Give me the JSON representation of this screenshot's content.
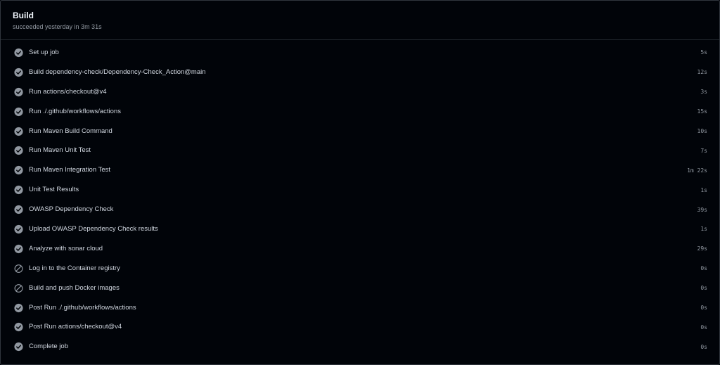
{
  "job": {
    "title": "Build",
    "status": "succeeded yesterday in 3m 31s"
  },
  "colors": {
    "background": "#010409",
    "icon": "#9198a1",
    "text": "#d1d7e0",
    "muted": "#9198a1"
  },
  "steps": [
    {
      "name": "Set up job",
      "duration": "5s",
      "status": "success",
      "icon": "check-circle-icon"
    },
    {
      "name": "Build dependency-check/Dependency-Check_Action@main",
      "duration": "12s",
      "status": "success",
      "icon": "check-circle-icon"
    },
    {
      "name": "Run actions/checkout@v4",
      "duration": "3s",
      "status": "success",
      "icon": "check-circle-icon"
    },
    {
      "name": "Run ./.github/workflows/actions",
      "duration": "15s",
      "status": "success",
      "icon": "check-circle-icon"
    },
    {
      "name": "Run Maven Build Command",
      "duration": "10s",
      "status": "success",
      "icon": "check-circle-icon"
    },
    {
      "name": "Run Maven Unit Test",
      "duration": "7s",
      "status": "success",
      "icon": "check-circle-icon"
    },
    {
      "name": "Run Maven Integration Test",
      "duration": "1m 22s",
      "status": "success",
      "icon": "check-circle-icon"
    },
    {
      "name": "Unit Test Results",
      "duration": "1s",
      "status": "success",
      "icon": "check-circle-icon"
    },
    {
      "name": "OWASP Dependency Check",
      "duration": "39s",
      "status": "success",
      "icon": "check-circle-icon"
    },
    {
      "name": "Upload OWASP Dependency Check results",
      "duration": "1s",
      "status": "success",
      "icon": "check-circle-icon"
    },
    {
      "name": "Analyze with sonar cloud",
      "duration": "29s",
      "status": "success",
      "icon": "check-circle-icon"
    },
    {
      "name": "Log in to the Container registry",
      "duration": "0s",
      "status": "skipped",
      "icon": "skipped-icon"
    },
    {
      "name": "Build and push Docker images",
      "duration": "0s",
      "status": "skipped",
      "icon": "skipped-icon"
    },
    {
      "name": "Post Run ./.github/workflows/actions",
      "duration": "0s",
      "status": "success",
      "icon": "check-circle-icon"
    },
    {
      "name": "Post Run actions/checkout@v4",
      "duration": "0s",
      "status": "success",
      "icon": "check-circle-icon"
    },
    {
      "name": "Complete job",
      "duration": "0s",
      "status": "success",
      "icon": "check-circle-icon"
    }
  ]
}
